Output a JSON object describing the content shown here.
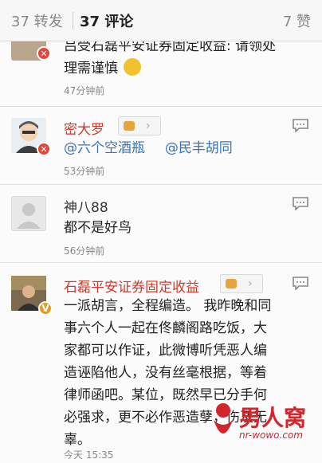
{
  "tabs": {
    "reposts": "37 转发",
    "comments": "37 评论",
    "likes": "7 赞"
  },
  "comments": [
    {
      "text_top": "吕受石磊平安证券固定收益: 请领处",
      "text_bottom": "理需谨慎",
      "time": "47分钟前"
    },
    {
      "name": "密大罗",
      "mention1": "@六个空酒瓶",
      "mention2": "@民丰胡同",
      "time": "53分钟前"
    },
    {
      "name": "神八88",
      "text": "都不是好鸟",
      "time": "56分钟前"
    },
    {
      "name": "石磊平安证券固定收益",
      "lines": [
        "一派胡言，全程编造。 我昨晚和同",
        "事六个人一起在佟麟阁路吃饭，大",
        "家都可以作证，此微博听凭恶人编",
        "造诬陷他人，没有丝毫根据，等着",
        "律师函吧。某位，既然早已分手何",
        "必强求，更不必作恶造孽，伤及无",
        "辜。"
      ],
      "time": "今天 15:35"
    }
  ],
  "watermark": {
    "brand": "男人窝",
    "url": "nr-wowo.com"
  },
  "colors": {
    "name_red": "#d0392b",
    "mention_blue": "#3a73b8"
  }
}
